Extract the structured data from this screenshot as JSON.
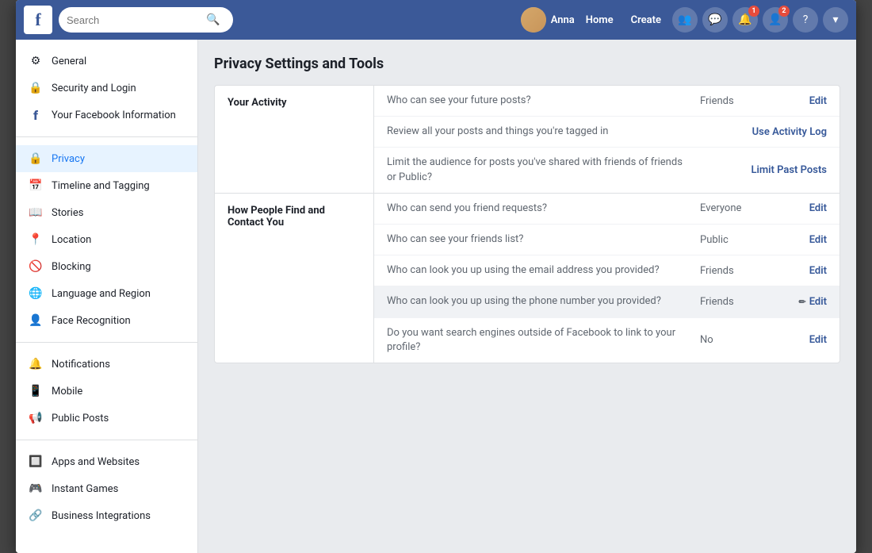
{
  "header": {
    "logo": "f",
    "search_placeholder": "Search",
    "user_name": "Anna",
    "nav_items": [
      "Home",
      "Create"
    ],
    "icon_buttons": [
      {
        "name": "friends-icon",
        "symbol": "👥",
        "badge": null
      },
      {
        "name": "messenger-icon",
        "symbol": "💬",
        "badge": null
      },
      {
        "name": "notifications-icon",
        "symbol": "🔔",
        "badge": "1"
      },
      {
        "name": "friend-requests-icon",
        "symbol": "👤",
        "badge": "2"
      },
      {
        "name": "help-icon",
        "symbol": "?",
        "badge": null
      },
      {
        "name": "dropdown-icon",
        "symbol": "▾",
        "badge": null
      }
    ]
  },
  "sidebar": {
    "sections": [
      {
        "items": [
          {
            "icon": "⚙",
            "label": "General",
            "active": false
          },
          {
            "icon": "🔒",
            "label": "Security and Login",
            "active": false
          },
          {
            "icon": "🔵",
            "label": "Your Facebook Information",
            "active": false
          }
        ]
      },
      {
        "items": [
          {
            "icon": "🔒",
            "label": "Privacy",
            "active": true
          },
          {
            "icon": "📅",
            "label": "Timeline and Tagging",
            "active": false
          },
          {
            "icon": "📖",
            "label": "Stories",
            "active": false
          },
          {
            "icon": "📍",
            "label": "Location",
            "active": false
          },
          {
            "icon": "🚫",
            "label": "Blocking",
            "active": false
          },
          {
            "icon": "🌐",
            "label": "Language and Region",
            "active": false
          },
          {
            "icon": "👤",
            "label": "Face Recognition",
            "active": false
          }
        ]
      },
      {
        "items": [
          {
            "icon": "🔔",
            "label": "Notifications",
            "active": false
          },
          {
            "icon": "📱",
            "label": "Mobile",
            "active": false
          },
          {
            "icon": "📢",
            "label": "Public Posts",
            "active": false
          }
        ]
      },
      {
        "items": [
          {
            "icon": "🔲",
            "label": "Apps and Websites",
            "active": false
          },
          {
            "icon": "🎮",
            "label": "Instant Games",
            "active": false
          },
          {
            "icon": "🔗",
            "label": "Business Integrations",
            "active": false
          }
        ]
      }
    ]
  },
  "content": {
    "page_title": "Privacy Settings and Tools",
    "sections": [
      {
        "title": "Your Activity",
        "rows": [
          {
            "label": "Who can see your future posts?",
            "value": "Friends",
            "action": "Edit",
            "action_type": "edit",
            "highlighted": false
          },
          {
            "label": "Review all your posts and things you're tagged in",
            "value": "",
            "action": "Use Activity Log",
            "action_type": "link",
            "highlighted": false
          },
          {
            "label": "Limit the audience for posts you've shared with friends of friends or Public?",
            "value": "",
            "action": "Limit Past Posts",
            "action_type": "link",
            "highlighted": false
          }
        ]
      },
      {
        "title": "How People Find and Contact You",
        "rows": [
          {
            "label": "Who can send you friend requests?",
            "value": "Everyone",
            "action": "Edit",
            "action_type": "edit",
            "highlighted": false
          },
          {
            "label": "Who can see your friends list?",
            "value": "Public",
            "action": "Edit",
            "action_type": "edit",
            "highlighted": false
          },
          {
            "label": "Who can look you up using the email address you provided?",
            "value": "Friends",
            "action": "Edit",
            "action_type": "edit",
            "highlighted": false
          },
          {
            "label": "Who can look you up using the phone number you provided?",
            "value": "Friends",
            "action": "Edit",
            "action_type": "edit",
            "highlighted": true,
            "has_pencil": true
          },
          {
            "label": "Do you want search engines outside of Facebook to link to your profile?",
            "value": "No",
            "action": "Edit",
            "action_type": "edit",
            "highlighted": false
          }
        ]
      }
    ]
  }
}
